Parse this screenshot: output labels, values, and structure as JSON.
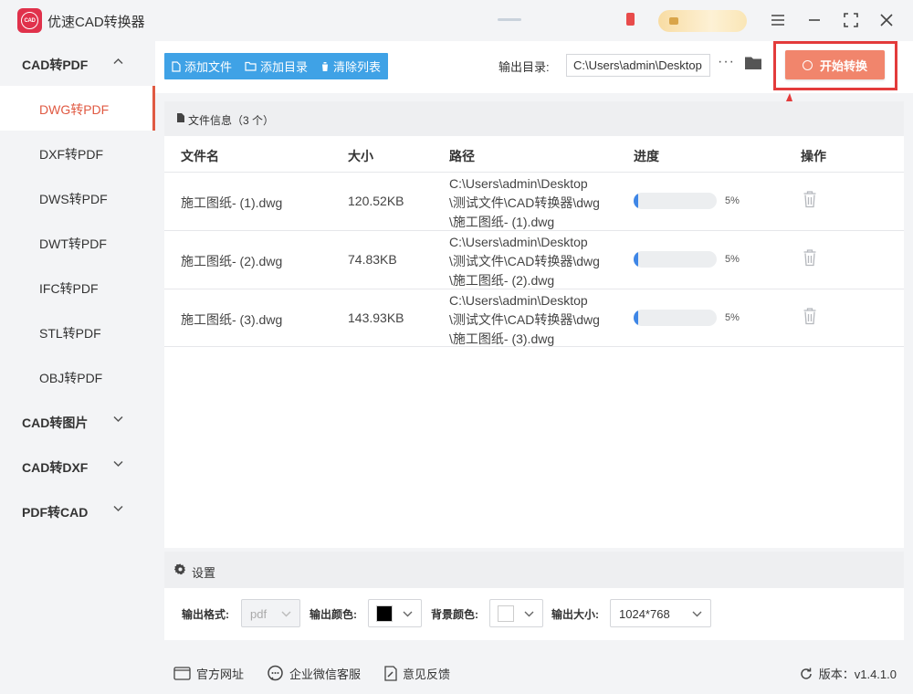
{
  "app": {
    "title": "优速CAD转换器",
    "logo_text": "CAD"
  },
  "sidebar": {
    "groups": [
      {
        "label": "CAD转PDF",
        "expanded": true
      },
      {
        "label": "CAD转图片",
        "expanded": false
      },
      {
        "label": "CAD转DXF",
        "expanded": false
      },
      {
        "label": "PDF转CAD",
        "expanded": false
      }
    ],
    "items": [
      {
        "label": "DWG转PDF",
        "active": true
      },
      {
        "label": "DXF转PDF"
      },
      {
        "label": "DWS转PDF"
      },
      {
        "label": "DWT转PDF"
      },
      {
        "label": "IFC转PDF"
      },
      {
        "label": "STL转PDF"
      },
      {
        "label": "OBJ转PDF"
      }
    ]
  },
  "toolbar": {
    "add_file": "添加文件",
    "add_folder": "添加目录",
    "clear_list": "清除列表",
    "output_label": "输出目录:",
    "output_path": "C:\\Users\\admin\\Desktop",
    "more": "···",
    "start": "开始转换"
  },
  "file_info": {
    "title": "文件信息（3 个）",
    "columns": [
      "文件名",
      "大小",
      "路径",
      "进度",
      "操作"
    ],
    "rows": [
      {
        "name": "施工图纸- (1).dwg",
        "size": "120.52KB",
        "path": [
          "C:\\Users\\admin\\Desktop",
          "\\测试文件\\CAD转换器\\dwg",
          "\\施工图纸- (1).dwg"
        ],
        "progress": 5,
        "progress_text": "5%"
      },
      {
        "name": "施工图纸- (2).dwg",
        "size": "74.83KB",
        "path": [
          "C:\\Users\\admin\\Desktop",
          "\\测试文件\\CAD转换器\\dwg",
          "\\施工图纸- (2).dwg"
        ],
        "progress": 5,
        "progress_text": "5%"
      },
      {
        "name": "施工图纸- (3).dwg",
        "size": "143.93KB",
        "path": [
          "C:\\Users\\admin\\Desktop",
          "\\测试文件\\CAD转换器\\dwg",
          "\\施工图纸- (3).dwg"
        ],
        "progress": 5,
        "progress_text": "5%"
      }
    ]
  },
  "settings": {
    "title": "设置",
    "format_label": "输出格式:",
    "format_value": "pdf",
    "color_label": "输出颜色:",
    "color_value": "#000000",
    "bg_label": "背景颜色:",
    "bg_value": "#ffffff",
    "size_label": "输出大小:",
    "size_value": "1024*768"
  },
  "footer": {
    "website": "官方网址",
    "wechat": "企业微信客服",
    "feedback": "意见反馈",
    "version": "版本：v1.4.1.0"
  },
  "colors": {
    "accent": "#e05a43",
    "toolbar": "#3fa2e6",
    "start": "#f1856c",
    "highlight": "#e33b3b",
    "progress": "#3e86e6"
  }
}
